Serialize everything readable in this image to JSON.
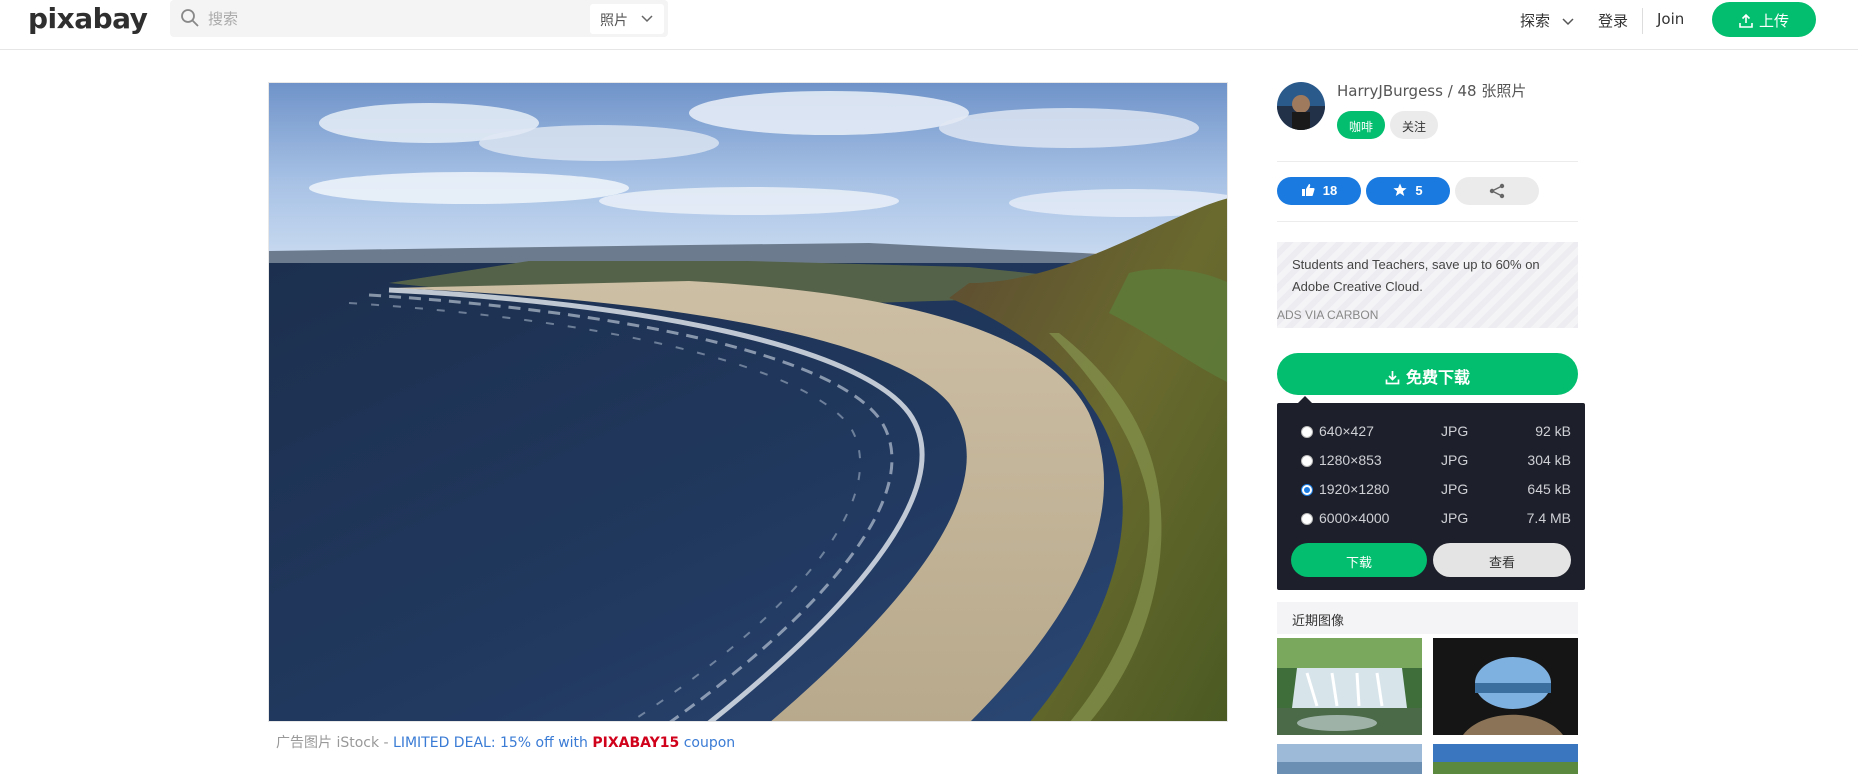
{
  "header": {
    "logo": "pixabay",
    "search_placeholder": "搜索",
    "search_type": "照片",
    "nav_explore": "探索",
    "nav_login": "登录",
    "nav_join": "Join",
    "upload_label": "上传"
  },
  "main": {
    "ad": {
      "prefix": "广告图片 iStock - ",
      "deal": "LIMITED DEAL: 15% off with ",
      "code": "PIXABAY15",
      "suffix": " coupon"
    }
  },
  "sidebar": {
    "author": "HarryJBurgess / 48 张照片",
    "coffee_label": "咖啡",
    "follow_label": "关注",
    "likes": "18",
    "favorites": "5",
    "carbon": {
      "text": "Students and Teachers, save up to 60% on Adobe Creative Cloud.",
      "via": "ADS VIA CARBON"
    },
    "download_label": "免费下载",
    "download_options": [
      {
        "resolution": "640×427",
        "format": "JPG",
        "size": "92 kB",
        "selected": false
      },
      {
        "resolution": "1280×853",
        "format": "JPG",
        "size": "304 kB",
        "selected": false
      },
      {
        "resolution": "1920×1280",
        "format": "JPG",
        "size": "645 kB",
        "selected": true
      },
      {
        "resolution": "6000×4000",
        "format": "JPG",
        "size": "7.4 MB",
        "selected": false
      }
    ],
    "download_go": "下载",
    "download_view": "查看",
    "recent_label": "近期图像"
  },
  "colors": {
    "accent_green": "#02be6e",
    "accent_blue": "#1a7ae0",
    "panel_dark": "#1d1f2a"
  }
}
